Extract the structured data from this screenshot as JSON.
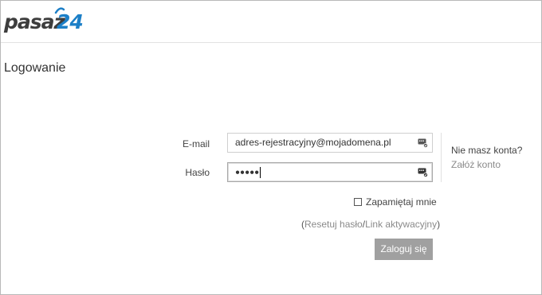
{
  "header": {
    "logo_main": "pasaz",
    "logo_num": "24"
  },
  "page": {
    "title": "Logowanie"
  },
  "form": {
    "email_label": "E-mail",
    "email_value": "adres-rejestracyjny@mojadomena.pl",
    "password_label": "Hasło",
    "password_masked": "●●●●●",
    "remember_label": "Zapamiętaj mnie",
    "remember_checked": false,
    "links_open": "(",
    "reset_password": "Resetuj hasło",
    "links_sep": "/",
    "activation_link": "Link aktywacyjny",
    "links_close": ")",
    "submit_label": "Zaloguj się"
  },
  "register": {
    "question": "Nie masz konta?",
    "link": "Załóż konto"
  },
  "icons": {
    "field_icon": "password-manager-icon",
    "accent": "#1c7fc7"
  }
}
